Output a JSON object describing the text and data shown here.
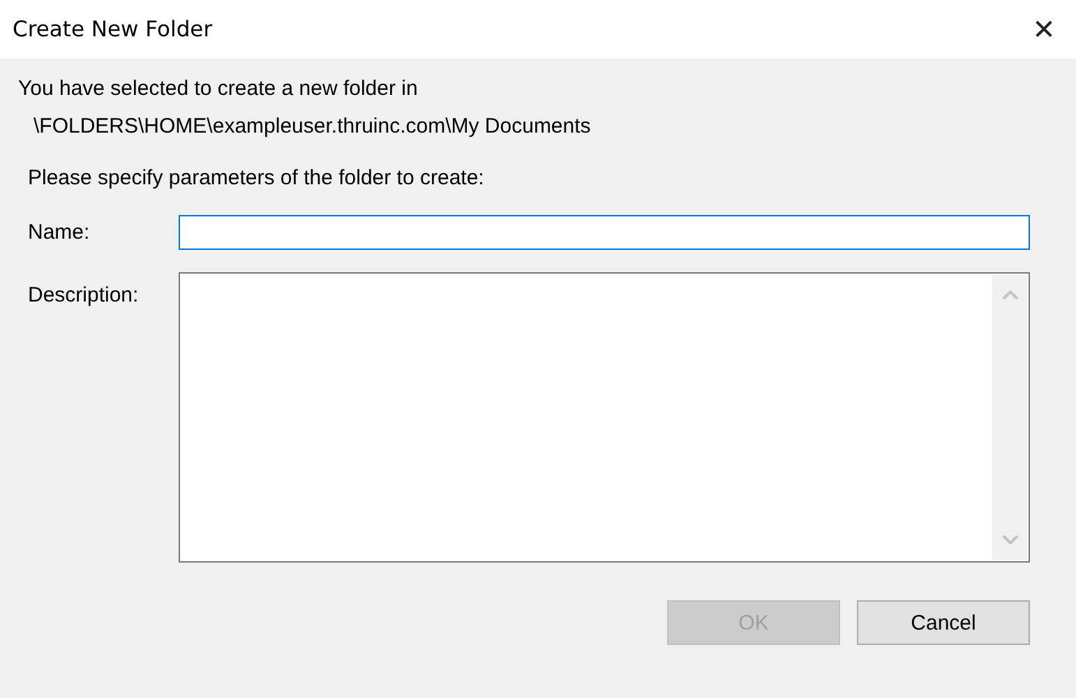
{
  "window": {
    "title": "Create New Folder",
    "close_glyph": "✕"
  },
  "intro": "You have selected to create a new folder in",
  "path": "\\FOLDERS\\HOME\\exampleuser.thruinc.com\\My Documents",
  "instruction": "Please specify parameters of the folder to create:",
  "fields": [
    {
      "kind": "text",
      "label": "Name:",
      "focused": true
    },
    {
      "kind": "textarea",
      "label": "Description:",
      "focused": false
    }
  ],
  "buttons": [
    {
      "label": "OK",
      "disabled": true
    },
    {
      "label": "Cancel",
      "disabled": false
    }
  ]
}
